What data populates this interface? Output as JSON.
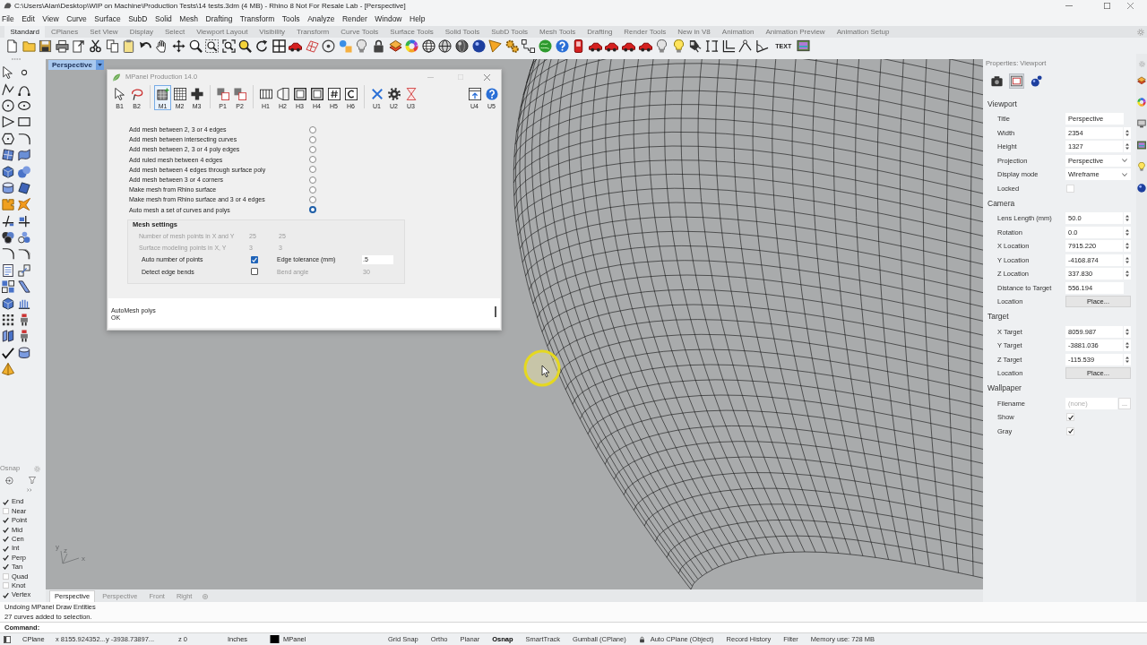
{
  "window": {
    "title": "C:\\Users\\Alan\\Desktop\\WIP on Machine\\Production Tests\\14 tests.3dm (4 MB) - Rhino 8 Not For Resale Lab - [Perspective]"
  },
  "menu": [
    "File",
    "Edit",
    "View",
    "Curve",
    "Surface",
    "SubD",
    "Solid",
    "Mesh",
    "Drafting",
    "Transform",
    "Tools",
    "Analyze",
    "Render",
    "Window",
    "Help"
  ],
  "toolbar_tabs": [
    {
      "label": "Standard",
      "selected": true
    },
    {
      "label": "CPlanes",
      "selected": false
    },
    {
      "label": "Set View",
      "selected": false
    },
    {
      "label": "Display",
      "selected": false
    },
    {
      "label": "Select",
      "selected": false
    },
    {
      "label": "Viewport Layout",
      "selected": false
    },
    {
      "label": "Visibility",
      "selected": false
    },
    {
      "label": "Transform",
      "selected": false
    },
    {
      "label": "Curve Tools",
      "selected": false
    },
    {
      "label": "Surface Tools",
      "selected": false
    },
    {
      "label": "Solid Tools",
      "selected": false
    },
    {
      "label": "SubD Tools",
      "selected": false
    },
    {
      "label": "Mesh Tools",
      "selected": false
    },
    {
      "label": "Drafting",
      "selected": false
    },
    {
      "label": "Render Tools",
      "selected": false
    },
    {
      "label": "New in V8",
      "selected": false
    },
    {
      "label": "Animation",
      "selected": false
    },
    {
      "label": "Animation Preview",
      "selected": false
    },
    {
      "label": "Animation Setup",
      "selected": false
    }
  ],
  "toolbar": {
    "text_tool": "TEXT"
  },
  "osnap": {
    "title": "Osnap",
    "items": [
      {
        "label": "End",
        "checked": true
      },
      {
        "label": "Near",
        "checked": false
      },
      {
        "label": "Point",
        "checked": true
      },
      {
        "label": "Mid",
        "checked": true
      },
      {
        "label": "Cen",
        "checked": true
      },
      {
        "label": "Int",
        "checked": true
      },
      {
        "label": "Perp",
        "checked": true
      },
      {
        "label": "Tan",
        "checked": true
      },
      {
        "label": "Quad",
        "checked": false
      },
      {
        "label": "Knot",
        "checked": false
      },
      {
        "label": "Vertex",
        "checked": true
      }
    ]
  },
  "viewport": {
    "title": "Perspective",
    "axes": [
      "y",
      "z",
      "x"
    ]
  },
  "mpanel": {
    "title": "MPanel Production 14.0",
    "tool_groups": [
      [
        {
          "label": "B1",
          "selected": false
        },
        {
          "label": "B2",
          "selected": false
        }
      ],
      [
        {
          "label": "M1",
          "selected": true
        },
        {
          "label": "M2",
          "selected": false
        },
        {
          "label": "M3",
          "selected": false
        }
      ],
      [
        {
          "label": "P1",
          "selected": false
        },
        {
          "label": "P2",
          "selected": false
        }
      ],
      [
        {
          "label": "H1",
          "selected": false
        },
        {
          "label": "H2",
          "selected": false
        },
        {
          "label": "H3",
          "selected": false
        },
        {
          "label": "H4",
          "selected": false
        },
        {
          "label": "H5",
          "selected": false
        },
        {
          "label": "H6",
          "selected": false
        }
      ],
      [
        {
          "label": "U1",
          "selected": false
        },
        {
          "label": "U2",
          "selected": false
        },
        {
          "label": "U3",
          "selected": false
        }
      ],
      [
        {
          "label": "U4",
          "selected": false
        },
        {
          "label": "U5",
          "selected": false
        }
      ]
    ],
    "options": [
      {
        "label": "Add mesh between 2, 3 or 4 edges",
        "selected": false
      },
      {
        "label": "Add mesh between intersecting curves",
        "selected": false
      },
      {
        "label": "Add mesh between 2, 3 or 4 poly edges",
        "selected": false
      },
      {
        "label": "Add ruled mesh between 4 edges",
        "selected": false
      },
      {
        "label": "Add mesh between 4 edges through surface poly",
        "selected": false
      },
      {
        "label": "Add mesh between 3 or 4 corners",
        "selected": false
      },
      {
        "label": "Make mesh from Rhino surface",
        "selected": false
      },
      {
        "label": "Make mesh from Rhino surface and 3 or 4 edges",
        "selected": false
      },
      {
        "label": "Auto mesh a set of curves and polys",
        "selected": true
      }
    ],
    "mesh_settings": {
      "title": "Mesh settings",
      "rows": [
        {
          "kind": "pair",
          "label": "Number of mesh points in X and Y",
          "values": [
            "25",
            "25"
          ],
          "disabled": true
        },
        {
          "kind": "pair",
          "label": "Surface modeling points in X, Y",
          "values": [
            "3",
            "3"
          ],
          "disabled": true
        },
        {
          "kind": "check",
          "label": "Auto number of points",
          "checked": true,
          "field": {
            "label": "Edge tolerance (mm)",
            "value": ".5",
            "disabled": false
          }
        },
        {
          "kind": "check",
          "label": "Detect edge bends",
          "checked": false,
          "field": {
            "label": "Bend angle",
            "value": "30",
            "disabled": true
          }
        }
      ]
    },
    "output": [
      "AutoMesh polys",
      "OK"
    ]
  },
  "viewport_tabs": [
    {
      "label": "Perspective",
      "selected": true
    },
    {
      "label": "Perspective",
      "selected": false
    },
    {
      "label": "Front",
      "selected": false
    },
    {
      "label": "Right",
      "selected": false
    }
  ],
  "properties": {
    "title": "Properties: Viewport",
    "pages": [
      {
        "selected": false
      },
      {
        "selected": true
      },
      {
        "selected": false
      }
    ],
    "sections": [
      {
        "title": "Viewport",
        "rows": [
          {
            "label": "Title",
            "kind": "text",
            "value": "Perspective"
          },
          {
            "label": "Width",
            "kind": "spinner",
            "value": "2354"
          },
          {
            "label": "Height",
            "kind": "spinner",
            "value": "1327"
          },
          {
            "label": "Projection",
            "kind": "dropdown",
            "value": "Perspective"
          },
          {
            "label": "Display mode",
            "kind": "dropdown",
            "value": "Wireframe"
          },
          {
            "label": "Locked",
            "kind": "checkbox",
            "checked": false
          }
        ]
      },
      {
        "title": "Camera",
        "rows": [
          {
            "label": "Lens Length (mm)",
            "kind": "spinner",
            "value": "50.0"
          },
          {
            "label": "Rotation",
            "kind": "spinner",
            "value": "0.0"
          },
          {
            "label": "X Location",
            "kind": "spinner",
            "value": "7915.220"
          },
          {
            "label": "Y Location",
            "kind": "spinner",
            "value": "-4168.874"
          },
          {
            "label": "Z Location",
            "kind": "spinner",
            "value": "337.830"
          },
          {
            "label": "Distance to Target",
            "kind": "text",
            "value": "556.194"
          },
          {
            "label": "Location",
            "kind": "button",
            "value": "Place..."
          }
        ]
      },
      {
        "title": "Target",
        "rows": [
          {
            "label": "X Target",
            "kind": "spinner",
            "value": "8059.987"
          },
          {
            "label": "Y Target",
            "kind": "spinner",
            "value": "-3881.036"
          },
          {
            "label": "Z Target",
            "kind": "spinner",
            "value": "-115.539"
          },
          {
            "label": "Location",
            "kind": "button",
            "value": "Place..."
          }
        ]
      },
      {
        "title": "Wallpaper",
        "rows": [
          {
            "label": "Filename",
            "kind": "file",
            "placeholder": "(none)",
            "button": "..."
          },
          {
            "label": "Show",
            "kind": "checkbox",
            "checked": true
          },
          {
            "label": "Gray",
            "kind": "checkbox",
            "checked": true
          }
        ]
      }
    ]
  },
  "command_history": [
    "Undoing MPanel Draw Entities",
    "27 curves added to selection."
  ],
  "command_prompt": "Command:",
  "status_bar": {
    "cplane": "CPlane",
    "coordinates": "x 8155.924352...y -3938.73897...",
    "z": "z 0",
    "units": "Inches",
    "layer": "MPanel",
    "toggles": [
      {
        "kind": "toggle",
        "label": "Grid Snap",
        "on": false
      },
      {
        "kind": "toggle",
        "label": "Ortho",
        "on": false
      },
      {
        "kind": "toggle",
        "label": "Planar",
        "on": false
      },
      {
        "kind": "toggle",
        "label": "Osnap",
        "on": true
      },
      {
        "kind": "toggle",
        "label": "SmartTrack",
        "on": false
      },
      {
        "kind": "toggle",
        "label": "Gumball (CPlane)",
        "on": false
      },
      {
        "kind": "lock",
        "label": "Auto CPlane (Object)",
        "on": false
      },
      {
        "kind": "toggle",
        "label": "Record History",
        "on": false
      },
      {
        "kind": "toggle",
        "label": "Filter",
        "on": false
      }
    ],
    "memory": "Memory use: 728 MB"
  }
}
